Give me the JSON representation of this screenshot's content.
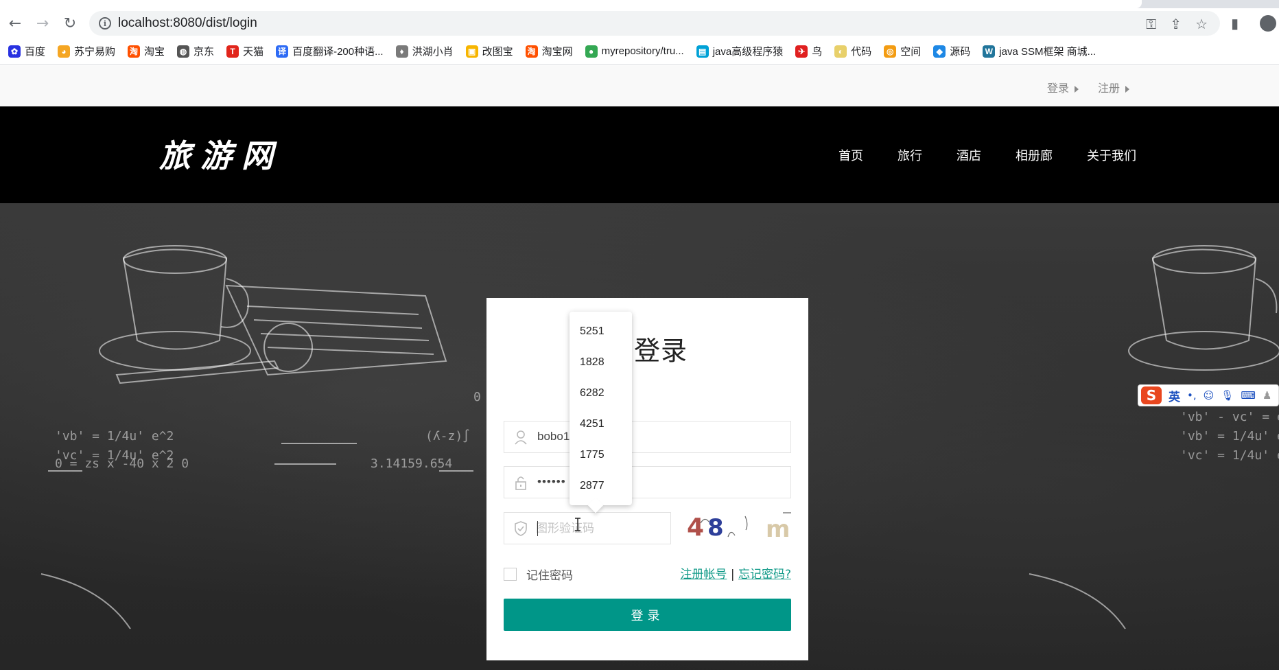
{
  "browser": {
    "url": "localhost:8080/dist/login",
    "bookmarks": [
      {
        "label": "百度",
        "color": "#2932e1",
        "glyph": "✿"
      },
      {
        "label": "苏宁易购",
        "color": "#f5a623",
        "glyph": "◕"
      },
      {
        "label": "淘宝",
        "color": "#ff5000",
        "glyph": "淘"
      },
      {
        "label": "京东",
        "color": "#555555",
        "glyph": "◍"
      },
      {
        "label": "天猫",
        "color": "#e1251b",
        "glyph": "T"
      },
      {
        "label": "百度翻译-200种语...",
        "color": "#2d6bf5",
        "glyph": "译"
      },
      {
        "label": "洪湖小肖",
        "color": "#7a7a7a",
        "glyph": "♦"
      },
      {
        "label": "改图宝",
        "color": "#f7b500",
        "glyph": "▣"
      },
      {
        "label": "淘宝网",
        "color": "#ff5000",
        "glyph": "淘"
      },
      {
        "label": "myrepository/tru...",
        "color": "#34a853",
        "glyph": "●"
      },
      {
        "label": "java高级程序猿",
        "color": "#00a1d6",
        "glyph": "▤"
      },
      {
        "label": "鸟",
        "color": "#e02020",
        "glyph": "✈"
      },
      {
        "label": "代码",
        "color": "#e8d06a",
        "glyph": "◐"
      },
      {
        "label": "空间",
        "color": "#f39c12",
        "glyph": "◎"
      },
      {
        "label": "源码",
        "color": "#1e88e5",
        "glyph": "◆"
      },
      {
        "label": "java SSM框架 商城...",
        "color": "#21759b",
        "glyph": "W"
      }
    ]
  },
  "site": {
    "topbar": {
      "login": "登录",
      "register": "注册"
    },
    "logo": "旅游网",
    "nav": [
      "首页",
      "旅行",
      "酒店",
      "相册廊",
      "关于我们"
    ]
  },
  "login": {
    "title": "户登录",
    "username_value": "bobo1",
    "password_value": "••••••",
    "captcha_placeholder": "图形验证码",
    "captcha_image_text": "48 m",
    "remember_label": "记住密码",
    "register_link": "注册帐号",
    "separator": "|",
    "forgot_link": "忘记密码?",
    "submit_label": "登录"
  },
  "autocomplete": {
    "options": [
      "5251",
      "1828",
      "6282",
      "4251",
      "1775",
      "2877"
    ]
  },
  "ime": {
    "lang": "英"
  }
}
